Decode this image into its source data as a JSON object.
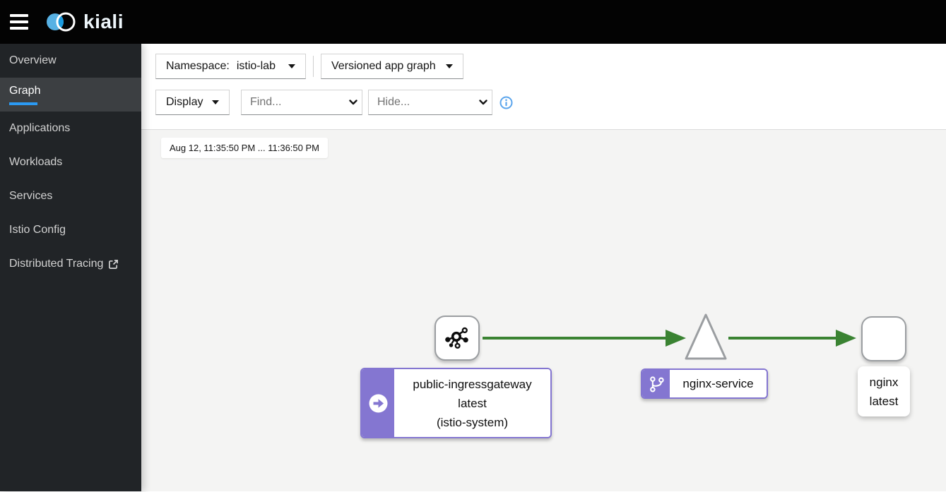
{
  "masthead": {
    "brand": "kiali",
    "menu_icon": "hamburger-icon",
    "logo_icon": "kiali-logo",
    "bg_color": "#030303"
  },
  "sidebar": {
    "bg_color": "#212427",
    "active_color": "#2b9af3",
    "items": [
      {
        "label": "Overview",
        "active": false
      },
      {
        "label": "Graph",
        "active": true
      },
      {
        "label": "Applications",
        "active": false
      },
      {
        "label": "Workloads",
        "active": false
      },
      {
        "label": "Services",
        "active": false
      },
      {
        "label": "Istio Config",
        "active": false
      },
      {
        "label": "Distributed Tracing",
        "active": false,
        "external_link": true
      }
    ]
  },
  "toolbar": {
    "namespace_label": "Namespace:",
    "namespace_value": "istio-lab",
    "graph_type_value": "Versioned app graph",
    "display_label": "Display",
    "find_placeholder": "Find...",
    "hide_placeholder": "Hide...",
    "info_icon": "info-circle-icon"
  },
  "graph": {
    "time_range": "Aug 12, 11:35:50 PM ... 11:36:50 PM",
    "nodes": [
      {
        "id": "public-ingressgateway",
        "shape": "rounded-square",
        "node_icon": "mesh-root-icon",
        "badge_icon": "arrow-circle-right-icon",
        "label_lines": [
          "public-ingressgateway",
          "latest",
          "(istio-system)"
        ]
      },
      {
        "id": "nginx-service",
        "shape": "triangle",
        "badge_icon": "code-branch-icon",
        "label_lines": [
          "nginx-service"
        ]
      },
      {
        "id": "nginx",
        "shape": "rounded-square",
        "label_lines": [
          "nginx",
          "latest"
        ]
      }
    ],
    "edges": [
      {
        "from": "public-ingressgateway",
        "to": "nginx-service",
        "status": "healthy"
      },
      {
        "from": "nginx-service",
        "to": "nginx",
        "status": "healthy"
      }
    ],
    "colors": {
      "edge_healthy": "#3a8332",
      "badge_purple": "#8476d1",
      "node_border": "#9b9ea1",
      "graph_bg": "#f4f4f3"
    }
  }
}
